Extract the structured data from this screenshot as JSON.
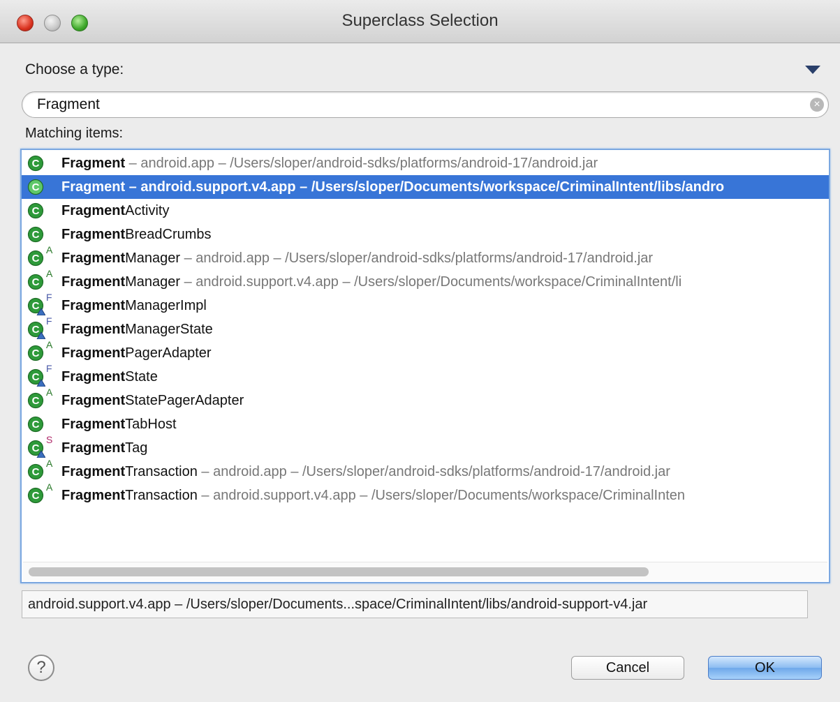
{
  "window": {
    "title": "Superclass Selection"
  },
  "chooser": {
    "choose_label": "Choose a type:",
    "search_value": "Fragment",
    "matching_label": "Matching items:"
  },
  "items": [
    {
      "bold": "Fragment",
      "rest": "",
      "detail": " – android.app – /Users/sloper/android-sdks/platforms/android-17/android.jar",
      "overlay": "",
      "icon": "class-icon",
      "selected": false
    },
    {
      "bold": "Fragment",
      "rest": "",
      "detail": " – android.support.v4.app – /Users/sloper/Documents/workspace/CriminalIntent/libs/andro",
      "overlay": "",
      "icon": "class-icon",
      "selected": true
    },
    {
      "bold": "Fragment",
      "rest": "Activity",
      "detail": "",
      "overlay": "",
      "icon": "class-icon",
      "selected": false
    },
    {
      "bold": "Fragment",
      "rest": "BreadCrumbs",
      "detail": "",
      "overlay": "",
      "icon": "class-icon",
      "selected": false
    },
    {
      "bold": "Fragment",
      "rest": "Manager",
      "detail": " – android.app – /Users/sloper/android-sdks/platforms/android-17/android.jar",
      "overlay": "A",
      "icon": "abstract-class-icon",
      "selected": false
    },
    {
      "bold": "Fragment",
      "rest": "Manager",
      "detail": " – android.support.v4.app – /Users/sloper/Documents/workspace/CriminalIntent/li",
      "overlay": "A",
      "icon": "abstract-class-icon",
      "selected": false
    },
    {
      "bold": "Fragment",
      "rest": "ManagerImpl",
      "detail": "",
      "overlay": "F",
      "icon": "final-default-class-icon",
      "selected": false
    },
    {
      "bold": "Fragment",
      "rest": "ManagerState",
      "detail": "",
      "overlay": "F",
      "icon": "final-default-class-icon",
      "selected": false
    },
    {
      "bold": "Fragment",
      "rest": "PagerAdapter",
      "detail": "",
      "overlay": "A",
      "icon": "abstract-class-icon",
      "selected": false
    },
    {
      "bold": "Fragment",
      "rest": "State",
      "detail": "",
      "overlay": "F",
      "icon": "final-default-class-icon",
      "selected": false
    },
    {
      "bold": "Fragment",
      "rest": "StatePagerAdapter",
      "detail": "",
      "overlay": "A",
      "icon": "abstract-class-icon",
      "selected": false
    },
    {
      "bold": "Fragment",
      "rest": "TabHost",
      "detail": "",
      "overlay": "",
      "icon": "class-icon",
      "selected": false
    },
    {
      "bold": "Fragment",
      "rest": "Tag",
      "detail": "",
      "overlay": "S",
      "icon": "static-default-class-icon",
      "selected": false
    },
    {
      "bold": "Fragment",
      "rest": "Transaction",
      "detail": " – android.app – /Users/sloper/android-sdks/platforms/android-17/android.jar",
      "overlay": "A",
      "icon": "abstract-class-icon",
      "selected": false
    },
    {
      "bold": "Fragment",
      "rest": "Transaction",
      "detail": " – android.support.v4.app – /Users/sloper/Documents/workspace/CriminalInten",
      "overlay": "A",
      "icon": "abstract-class-icon",
      "selected": false
    }
  ],
  "status_text": "android.support.v4.app – /Users/sloper/Documents...space/CriminalIntent/libs/android-support-v4.jar",
  "buttons": {
    "help": "?",
    "cancel": "Cancel",
    "ok": "OK"
  },
  "colors": {
    "selection": "#3875d7",
    "class_icon": "#2e9a3a",
    "ok_button": "#8cbcf1"
  }
}
